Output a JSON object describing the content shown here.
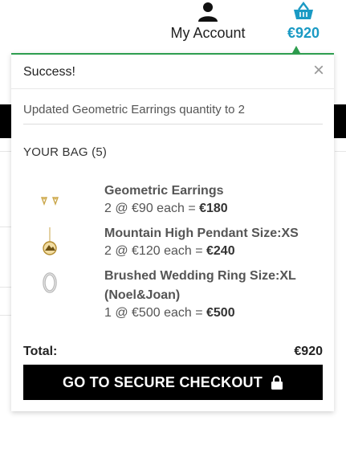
{
  "header": {
    "account_label": "My Account",
    "cart_total": "€920",
    "account_icon": "user-icon",
    "cart_icon": "basket-icon"
  },
  "colors": {
    "accent": "#2e9e4f",
    "cart_blue": "#1a9ac4"
  },
  "dropdown": {
    "alert_title": "Success!",
    "close_symbol": "×",
    "message": "Updated Geometric Earrings quantity to 2",
    "bag_title": "YOUR BAG (5)",
    "items": [
      {
        "name": "Geometric Earrings",
        "price_prefix": "2 @ €90 each = ",
        "price_total": "€180",
        "image": "earrings"
      },
      {
        "name": "Mountain High Pendant Size:XS",
        "price_prefix": "2 @ €120 each = ",
        "price_total": "€240",
        "image": "pendant"
      },
      {
        "name": "Brushed Wedding Ring Size:XL (Noel&Joan)",
        "price_prefix": "1 @ €500 each = ",
        "price_total": "€500",
        "image": "ring"
      }
    ],
    "total_label": "Total:",
    "total_value": "€920",
    "checkout_label": "GO TO SECURE CHECKOUT",
    "checkout_icon": "lock-icon"
  }
}
